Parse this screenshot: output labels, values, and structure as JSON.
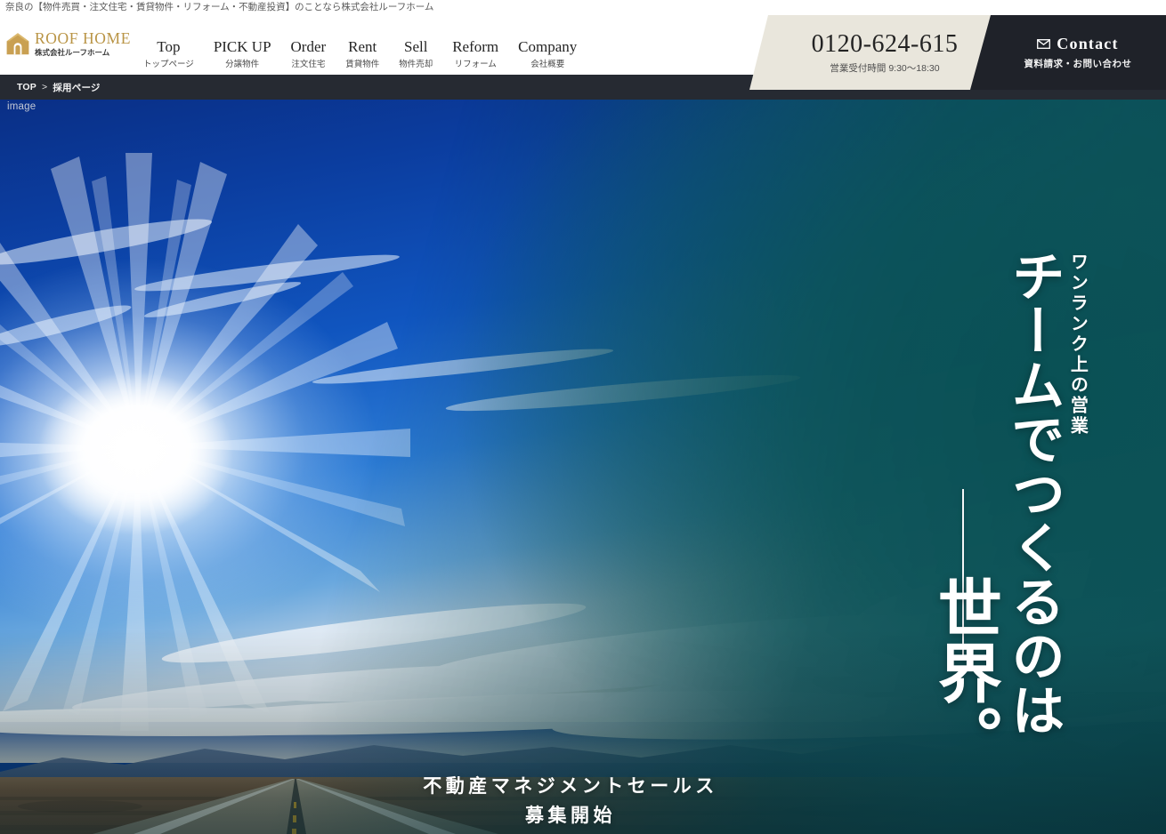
{
  "tagline": "奈良の【物件売買・注文住宅・賃貸物件・リフォーム・不動産投資】のことなら株式会社ルーフホーム",
  "brand": {
    "name_en": "ROOF HOME",
    "name_jp": "株式会社ルーフホーム",
    "logo_icon": "house-icon",
    "logo_color": "#b99445"
  },
  "nav": {
    "items": [
      {
        "en": "Top",
        "jp": "トップページ"
      },
      {
        "en": "PICK UP",
        "jp": "分譲物件"
      },
      {
        "en": "Order",
        "jp": "注文住宅"
      },
      {
        "en": "Rent",
        "jp": "賃貸物件"
      },
      {
        "en": "Sell",
        "jp": "物件売却"
      },
      {
        "en": "Reform",
        "jp": "リフォーム"
      },
      {
        "en": "Company",
        "jp": "会社概要"
      }
    ]
  },
  "phone": {
    "number": "0120-624-615",
    "hours": "営業受付時間 9:30〜18:30",
    "bg_color": "#e9e6dc"
  },
  "contact": {
    "icon": "mail-icon",
    "label_en": "Contact",
    "label_jp": "資料請求・お問い合わせ",
    "bg_color": "#1f2229"
  },
  "breadcrumb": {
    "bg_color": "#262a32",
    "home": "TOP",
    "separator": ">",
    "current": "採用ページ"
  },
  "hero": {
    "alt_text": "image",
    "kicker": "ワンランク上の営業",
    "headline_line1": "チームでつくるのは",
    "headline_line2": "世界。",
    "sub_line1": "不動産マネジメントセールス",
    "sub_line2": "募集開始",
    "accent_color": "#0a5054",
    "sky_color": "#0b47b4"
  }
}
